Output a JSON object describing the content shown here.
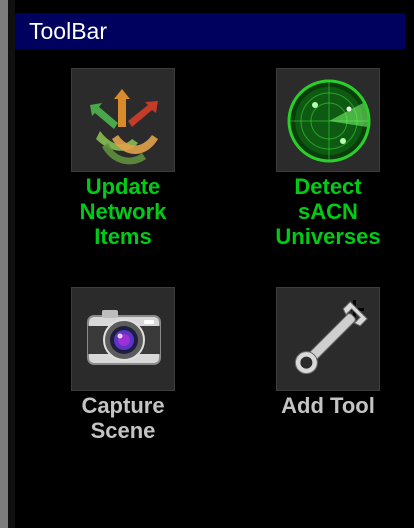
{
  "window": {
    "title": "ToolBar"
  },
  "tools": [
    {
      "label": "Update\nNetwork\nItems",
      "icon": "network-arrows-icon",
      "label_color": "#00cc17"
    },
    {
      "label": "Detect\nsACN\nUniverses",
      "icon": "radar-icon",
      "label_color": "#00cc17"
    },
    {
      "label": "Capture\nScene",
      "icon": "camera-icon",
      "label_color": "#c4c4c4"
    },
    {
      "label": "Add Tool",
      "icon": "wrench-add-icon",
      "label_color": "#c4c4c4"
    }
  ],
  "colors": {
    "titlebar_bg": "#00005e",
    "background": "#000000",
    "tile_bg": "#2c2c2c"
  }
}
